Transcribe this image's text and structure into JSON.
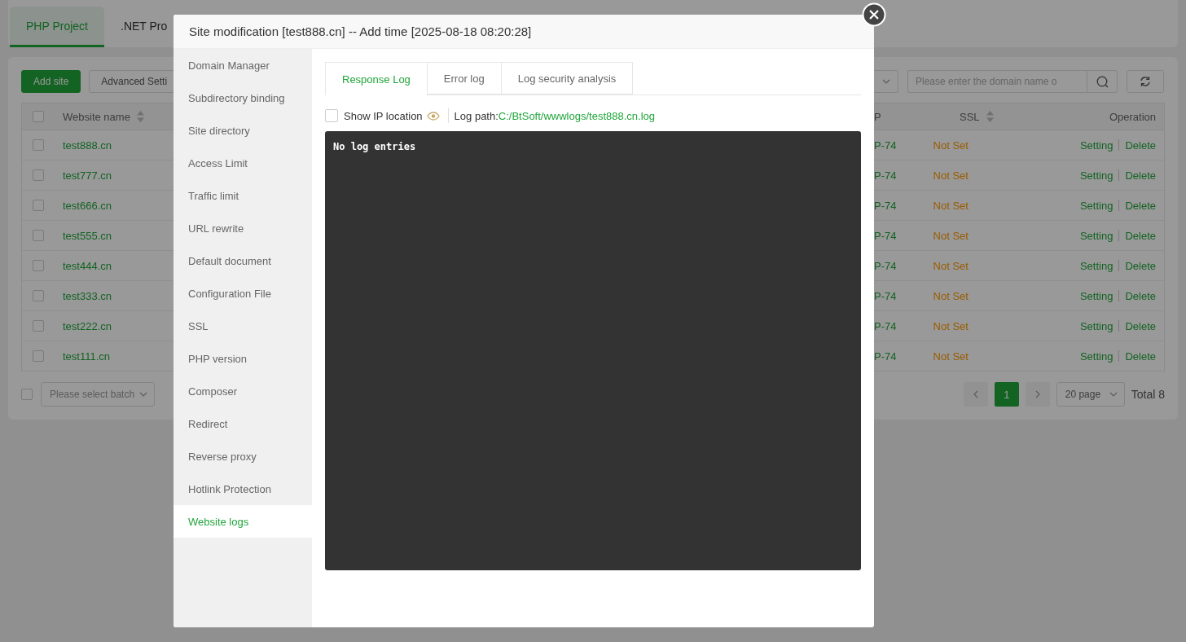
{
  "top_tabs": [
    {
      "label": "PHP Project",
      "selected": true
    },
    {
      "label": ".NET Pro",
      "selected": false
    }
  ],
  "toolbar": {
    "add_button": "Add site",
    "advanced_button": "Advanced Setti",
    "search": {
      "placeholder": "Please enter the domain name o"
    }
  },
  "table": {
    "select_all": false,
    "columns": [
      "Website name",
      "P",
      "SSL",
      "Operation"
    ],
    "rows": [
      {
        "checked": false,
        "name": "test888.cn",
        "php": "P-74",
        "ssl": "Not Set",
        "actions": [
          "Setting",
          "Delete"
        ]
      },
      {
        "checked": false,
        "name": "test777.cn",
        "php": "P-74",
        "ssl": "Not Set",
        "actions": [
          "Setting",
          "Delete"
        ]
      },
      {
        "checked": false,
        "name": "test666.cn",
        "php": "P-74",
        "ssl": "Not Set",
        "actions": [
          "Setting",
          "Delete"
        ]
      },
      {
        "checked": false,
        "name": "test555.cn",
        "php": "P-74",
        "ssl": "Not Set",
        "actions": [
          "Setting",
          "Delete"
        ]
      },
      {
        "checked": false,
        "name": "test444.cn",
        "php": "P-74",
        "ssl": "Not Set",
        "actions": [
          "Setting",
          "Delete"
        ]
      },
      {
        "checked": false,
        "name": "test333.cn",
        "php": "P-74",
        "ssl": "Not Set",
        "actions": [
          "Setting",
          "Delete"
        ]
      },
      {
        "checked": false,
        "name": "test222.cn",
        "php": "P-74",
        "ssl": "Not Set",
        "actions": [
          "Setting",
          "Delete"
        ]
      },
      {
        "checked": false,
        "name": "test111.cn",
        "php": "P-74",
        "ssl": "Not Set",
        "actions": [
          "Setting",
          "Delete"
        ]
      }
    ]
  },
  "batch": {
    "checked": false,
    "placeholder": "Please select batch"
  },
  "pagination": {
    "pages": [
      {
        "label": "1",
        "selected": true
      }
    ],
    "page_size": "20 page",
    "total": "Total 8"
  },
  "dialog": {
    "title": "Site modification [test888.cn] -- Add time [2025-08-18 08:20:28]",
    "menu": [
      {
        "label": "Domain Manager",
        "selected": false
      },
      {
        "label": "Subdirectory binding",
        "selected": false
      },
      {
        "label": "Site directory",
        "selected": false
      },
      {
        "label": "Access Limit",
        "selected": false
      },
      {
        "label": "Traffic limit",
        "selected": false
      },
      {
        "label": "URL rewrite",
        "selected": false
      },
      {
        "label": "Default document",
        "selected": false
      },
      {
        "label": "Configuration File",
        "selected": false
      },
      {
        "label": "SSL",
        "selected": false
      },
      {
        "label": "PHP version",
        "selected": false
      },
      {
        "label": "Composer",
        "selected": false
      },
      {
        "label": "Redirect",
        "selected": false
      },
      {
        "label": "Reverse proxy",
        "selected": false
      },
      {
        "label": "Hotlink Protection",
        "selected": false
      },
      {
        "label": "Website logs",
        "selected": true
      }
    ],
    "tabs": [
      {
        "label": "Response Log",
        "selected": true
      },
      {
        "label": "Error log",
        "selected": false
      },
      {
        "label": "Log security analysis",
        "selected": false
      }
    ],
    "show_ip": {
      "label": "Show IP location",
      "checked": false
    },
    "log_path_label": "Log path:",
    "log_path": "C:/BtSoft/wwwlogs/test888.cn.log",
    "log_text": "No log entries"
  }
}
